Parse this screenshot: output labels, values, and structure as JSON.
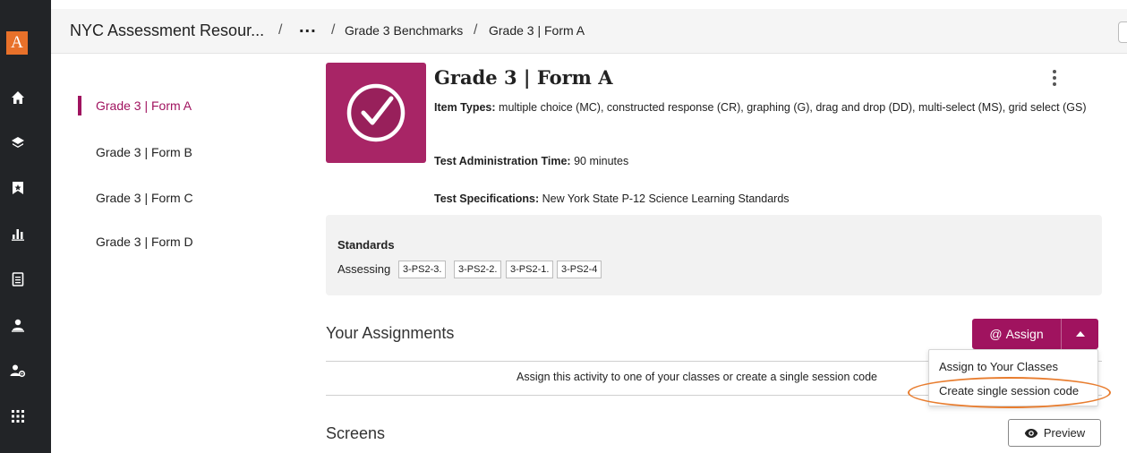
{
  "rail": {
    "logo_letter": "A",
    "logo_color": "#e8712a",
    "icons": [
      "home-icon",
      "library-icon",
      "bookmark-icon",
      "reports-icon",
      "document-icon",
      "classes-icon",
      "admin-icon",
      "apps-icon"
    ]
  },
  "breadcrumb": {
    "root": "NYC Assessment Resour...",
    "ellipsis": "...",
    "separator": "/",
    "items": [
      "Grade 3 Benchmarks",
      "Grade 3 | Form A"
    ]
  },
  "sidenav": {
    "items": [
      {
        "label": "Grade 3 | Form A",
        "active": true
      },
      {
        "label": "Grade 3 | Form B",
        "active": false
      },
      {
        "label": "Grade 3 | Form C",
        "active": false
      },
      {
        "label": "Grade 3 | Form D",
        "active": false
      }
    ]
  },
  "activity": {
    "title": "Grade 3 | Form A",
    "thumbnail_icon": "checkmark-circle-icon",
    "item_types_label": "Item Types:",
    "item_types_value": "multiple choice (MC), constructed response (CR), graphing (G), drag and drop (DD), multi-select (MS), grid select (GS)",
    "admin_time_label": "Test Administration Time:",
    "admin_time_value": "90 minutes",
    "specs_label": "Test Specifications:",
    "specs_value": "New York State P-12 Science Learning Standards"
  },
  "standards": {
    "title": "Standards",
    "assessing_label": "Assessing",
    "tags": [
      "3-PS2-3.",
      "3-PS2-2.",
      "3-PS2-1.",
      "3-PS2-4"
    ]
  },
  "assignments": {
    "title": "Your Assignments",
    "message": "Assign this activity to one of your classes or create a single session code",
    "assign_button": "Assign",
    "assign_icon": "@",
    "menu": [
      "Assign to Your Classes",
      "Create single session code"
    ]
  },
  "screens": {
    "title": "Screens",
    "preview_button": "Preview"
  },
  "colors": {
    "accent": "#a0135f",
    "rail_bg": "#222427",
    "highlight": "#e87d2f"
  }
}
